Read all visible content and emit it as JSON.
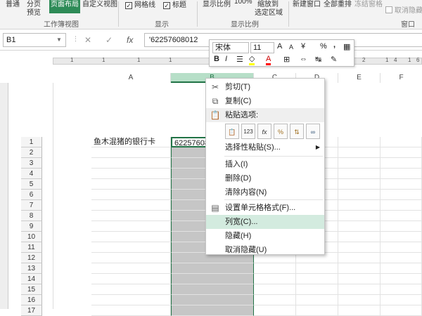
{
  "ribbon": {
    "items": [
      "普通",
      "分页\n预览",
      "页面布局",
      "自定义视图",
      "网格线",
      "标题",
      "显示比例",
      "100%",
      "缩放到\n选定区域",
      "新建窗口",
      "全部重排",
      "冻结窗格",
      "取消隐藏"
    ],
    "normal": "普通",
    "pagebreak_1": "分页",
    "pagebreak_2": "预览",
    "page_layout": "页面布局",
    "custom_view": "自定义视图",
    "gridlines": "网格线",
    "headings": "标题",
    "zoom": "显示比例",
    "zoom100": "100%",
    "zoom_sel_1": "缩放到",
    "zoom_sel_2": "选定区域",
    "new_window": "新建窗口",
    "arrange_all": "全部重排",
    "freeze": "冻结窗格",
    "unhide": "取消隐藏",
    "group_workbook_views": "工作簿视图",
    "group_show": "显示",
    "group_zoom": "显示比例",
    "group_window": "窗口"
  },
  "formula_bar": {
    "name_box": "B1",
    "cancel": "✕",
    "enter": "✓",
    "fx": "fx",
    "content": "'62257608012"
  },
  "ruler": {
    "marks": [
      "1",
      "1",
      "1",
      "1",
      "2",
      "1",
      "4",
      "1",
      "6"
    ]
  },
  "columns": [
    "A",
    "B",
    "C",
    "D",
    "E",
    "F"
  ],
  "rows": [
    "1",
    "2",
    "3",
    "4",
    "5",
    "6",
    "7",
    "8",
    "9",
    "10",
    "11",
    "12",
    "13",
    "14",
    "15",
    "16",
    "17"
  ],
  "cells": {
    "A1": "鱼木混猪的银行卡",
    "B1": "62257608"
  },
  "mini_toolbar": {
    "font": "宋体",
    "size": "11",
    "grow": "A",
    "shrink": "A",
    "currency": "¥",
    "percent": "%",
    "comma": ",",
    "bold": "B",
    "italic": "I",
    "fill_color": "#ffff00",
    "font_color": "#ff0000"
  },
  "context_menu": {
    "cut": "剪切(T)",
    "copy": "复制(C)",
    "paste_options": "粘贴选项:",
    "paste_special": "选择性粘贴(S)...",
    "insert": "插入(I)",
    "delete": "删除(D)",
    "clear": "清除内容(N)",
    "format_cells": "设置单元格格式(F)...",
    "column_width": "列宽(C)...",
    "hide": "隐藏(H)",
    "unhide": "取消隐藏(U)"
  },
  "colors": {
    "accent": "#217346",
    "selection": "#c6c6c6",
    "highlight": "#d3ebdf"
  }
}
